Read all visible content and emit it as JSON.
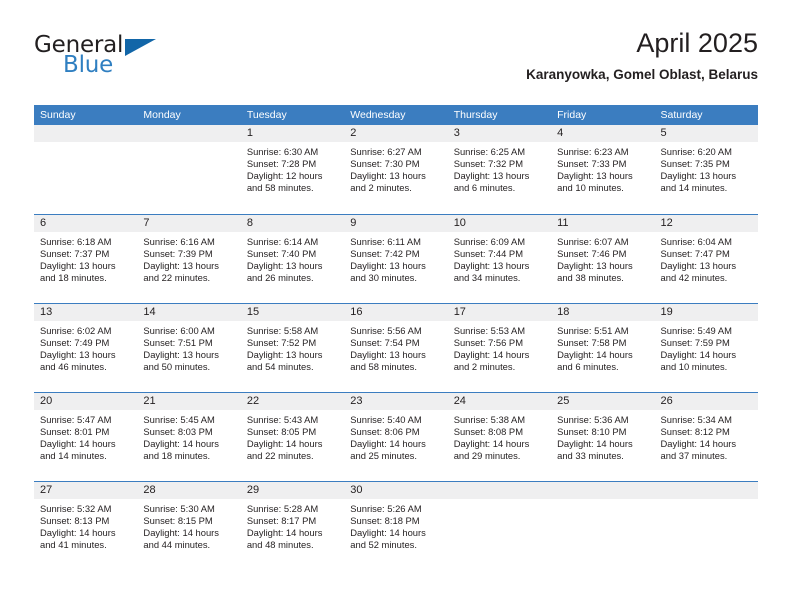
{
  "logo": {
    "primary_text": "General",
    "secondary_text": "Blue",
    "primary_color": "#221f20",
    "secondary_color": "#2f7fc1",
    "triangle_color": "#1266a8",
    "icon": "triangle-icon"
  },
  "header": {
    "title": "April 2025",
    "subtitle": "Karanyowka, Gomel Oblast, Belarus"
  },
  "theme": {
    "header_blue": "#3b7dc0",
    "daynum_band": "#efeff0",
    "text": "#231f20"
  },
  "calendar": {
    "weekday_headers": [
      "Sunday",
      "Monday",
      "Tuesday",
      "Wednesday",
      "Thursday",
      "Friday",
      "Saturday"
    ],
    "weeks": [
      [
        {
          "day": "",
          "sunrise": "",
          "sunset": "",
          "daylight": ""
        },
        {
          "day": "",
          "sunrise": "",
          "sunset": "",
          "daylight": ""
        },
        {
          "day": "1",
          "sunrise": "Sunrise: 6:30 AM",
          "sunset": "Sunset: 7:28 PM",
          "daylight": "Daylight: 12 hours and 58 minutes."
        },
        {
          "day": "2",
          "sunrise": "Sunrise: 6:27 AM",
          "sunset": "Sunset: 7:30 PM",
          "daylight": "Daylight: 13 hours and 2 minutes."
        },
        {
          "day": "3",
          "sunrise": "Sunrise: 6:25 AM",
          "sunset": "Sunset: 7:32 PM",
          "daylight": "Daylight: 13 hours and 6 minutes."
        },
        {
          "day": "4",
          "sunrise": "Sunrise: 6:23 AM",
          "sunset": "Sunset: 7:33 PM",
          "daylight": "Daylight: 13 hours and 10 minutes."
        },
        {
          "day": "5",
          "sunrise": "Sunrise: 6:20 AM",
          "sunset": "Sunset: 7:35 PM",
          "daylight": "Daylight: 13 hours and 14 minutes."
        }
      ],
      [
        {
          "day": "6",
          "sunrise": "Sunrise: 6:18 AM",
          "sunset": "Sunset: 7:37 PM",
          "daylight": "Daylight: 13 hours and 18 minutes."
        },
        {
          "day": "7",
          "sunrise": "Sunrise: 6:16 AM",
          "sunset": "Sunset: 7:39 PM",
          "daylight": "Daylight: 13 hours and 22 minutes."
        },
        {
          "day": "8",
          "sunrise": "Sunrise: 6:14 AM",
          "sunset": "Sunset: 7:40 PM",
          "daylight": "Daylight: 13 hours and 26 minutes."
        },
        {
          "day": "9",
          "sunrise": "Sunrise: 6:11 AM",
          "sunset": "Sunset: 7:42 PM",
          "daylight": "Daylight: 13 hours and 30 minutes."
        },
        {
          "day": "10",
          "sunrise": "Sunrise: 6:09 AM",
          "sunset": "Sunset: 7:44 PM",
          "daylight": "Daylight: 13 hours and 34 minutes."
        },
        {
          "day": "11",
          "sunrise": "Sunrise: 6:07 AM",
          "sunset": "Sunset: 7:46 PM",
          "daylight": "Daylight: 13 hours and 38 minutes."
        },
        {
          "day": "12",
          "sunrise": "Sunrise: 6:04 AM",
          "sunset": "Sunset: 7:47 PM",
          "daylight": "Daylight: 13 hours and 42 minutes."
        }
      ],
      [
        {
          "day": "13",
          "sunrise": "Sunrise: 6:02 AM",
          "sunset": "Sunset: 7:49 PM",
          "daylight": "Daylight: 13 hours and 46 minutes."
        },
        {
          "day": "14",
          "sunrise": "Sunrise: 6:00 AM",
          "sunset": "Sunset: 7:51 PM",
          "daylight": "Daylight: 13 hours and 50 minutes."
        },
        {
          "day": "15",
          "sunrise": "Sunrise: 5:58 AM",
          "sunset": "Sunset: 7:52 PM",
          "daylight": "Daylight: 13 hours and 54 minutes."
        },
        {
          "day": "16",
          "sunrise": "Sunrise: 5:56 AM",
          "sunset": "Sunset: 7:54 PM",
          "daylight": "Daylight: 13 hours and 58 minutes."
        },
        {
          "day": "17",
          "sunrise": "Sunrise: 5:53 AM",
          "sunset": "Sunset: 7:56 PM",
          "daylight": "Daylight: 14 hours and 2 minutes."
        },
        {
          "day": "18",
          "sunrise": "Sunrise: 5:51 AM",
          "sunset": "Sunset: 7:58 PM",
          "daylight": "Daylight: 14 hours and 6 minutes."
        },
        {
          "day": "19",
          "sunrise": "Sunrise: 5:49 AM",
          "sunset": "Sunset: 7:59 PM",
          "daylight": "Daylight: 14 hours and 10 minutes."
        }
      ],
      [
        {
          "day": "20",
          "sunrise": "Sunrise: 5:47 AM",
          "sunset": "Sunset: 8:01 PM",
          "daylight": "Daylight: 14 hours and 14 minutes."
        },
        {
          "day": "21",
          "sunrise": "Sunrise: 5:45 AM",
          "sunset": "Sunset: 8:03 PM",
          "daylight": "Daylight: 14 hours and 18 minutes."
        },
        {
          "day": "22",
          "sunrise": "Sunrise: 5:43 AM",
          "sunset": "Sunset: 8:05 PM",
          "daylight": "Daylight: 14 hours and 22 minutes."
        },
        {
          "day": "23",
          "sunrise": "Sunrise: 5:40 AM",
          "sunset": "Sunset: 8:06 PM",
          "daylight": "Daylight: 14 hours and 25 minutes."
        },
        {
          "day": "24",
          "sunrise": "Sunrise: 5:38 AM",
          "sunset": "Sunset: 8:08 PM",
          "daylight": "Daylight: 14 hours and 29 minutes."
        },
        {
          "day": "25",
          "sunrise": "Sunrise: 5:36 AM",
          "sunset": "Sunset: 8:10 PM",
          "daylight": "Daylight: 14 hours and 33 minutes."
        },
        {
          "day": "26",
          "sunrise": "Sunrise: 5:34 AM",
          "sunset": "Sunset: 8:12 PM",
          "daylight": "Daylight: 14 hours and 37 minutes."
        }
      ],
      [
        {
          "day": "27",
          "sunrise": "Sunrise: 5:32 AM",
          "sunset": "Sunset: 8:13 PM",
          "daylight": "Daylight: 14 hours and 41 minutes."
        },
        {
          "day": "28",
          "sunrise": "Sunrise: 5:30 AM",
          "sunset": "Sunset: 8:15 PM",
          "daylight": "Daylight: 14 hours and 44 minutes."
        },
        {
          "day": "29",
          "sunrise": "Sunrise: 5:28 AM",
          "sunset": "Sunset: 8:17 PM",
          "daylight": "Daylight: 14 hours and 48 minutes."
        },
        {
          "day": "30",
          "sunrise": "Sunrise: 5:26 AM",
          "sunset": "Sunset: 8:18 PM",
          "daylight": "Daylight: 14 hours and 52 minutes."
        },
        {
          "day": "",
          "sunrise": "",
          "sunset": "",
          "daylight": ""
        },
        {
          "day": "",
          "sunrise": "",
          "sunset": "",
          "daylight": ""
        },
        {
          "day": "",
          "sunrise": "",
          "sunset": "",
          "daylight": ""
        }
      ]
    ]
  }
}
